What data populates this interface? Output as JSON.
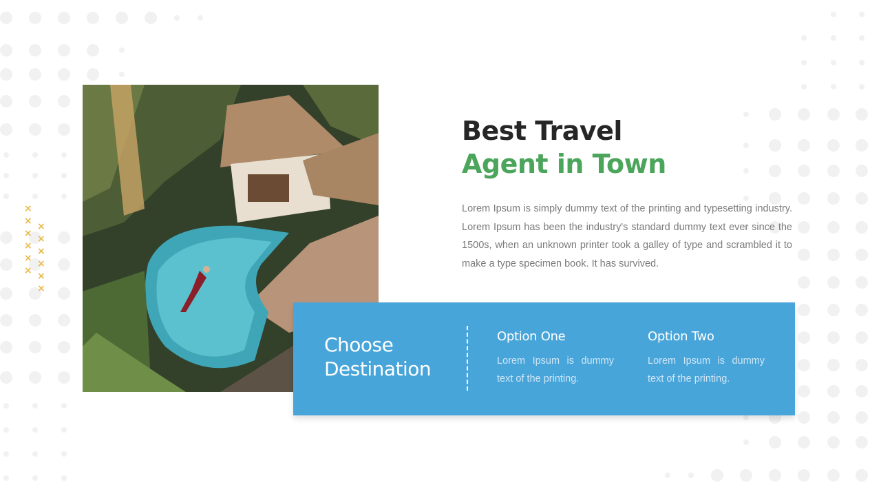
{
  "slide": {
    "heading": {
      "line1": "Best Travel",
      "line2": "Agent in Town"
    },
    "description": "Lorem Ipsum is simply dummy text of the printing and typesetting industry.  Lorem Ipsum has been the industry's standard dummy text ever since the 1500s,  when an unknown printer took a galley of type and scrambled it to make a type specimen book.  It has survived.",
    "image_alt": "Aerial view of a woman floating in a tropical pool surrounded by palm trees and thatched huts",
    "panel": {
      "title": "Choose Destination",
      "options": [
        {
          "title": "Option One",
          "text": "Lorem Ipsum is dummy text of the printing."
        },
        {
          "title": "Option Two",
          "text": "Lorem Ipsum is dummy text of the printing."
        }
      ]
    },
    "decoration": {
      "cross_icon": "×"
    },
    "colors": {
      "heading_dark": "#262626",
      "heading_accent": "#4ba55b",
      "panel_bg": "#48a5da",
      "cross": "#e9b94a",
      "dot": "#f1f1f1"
    }
  }
}
